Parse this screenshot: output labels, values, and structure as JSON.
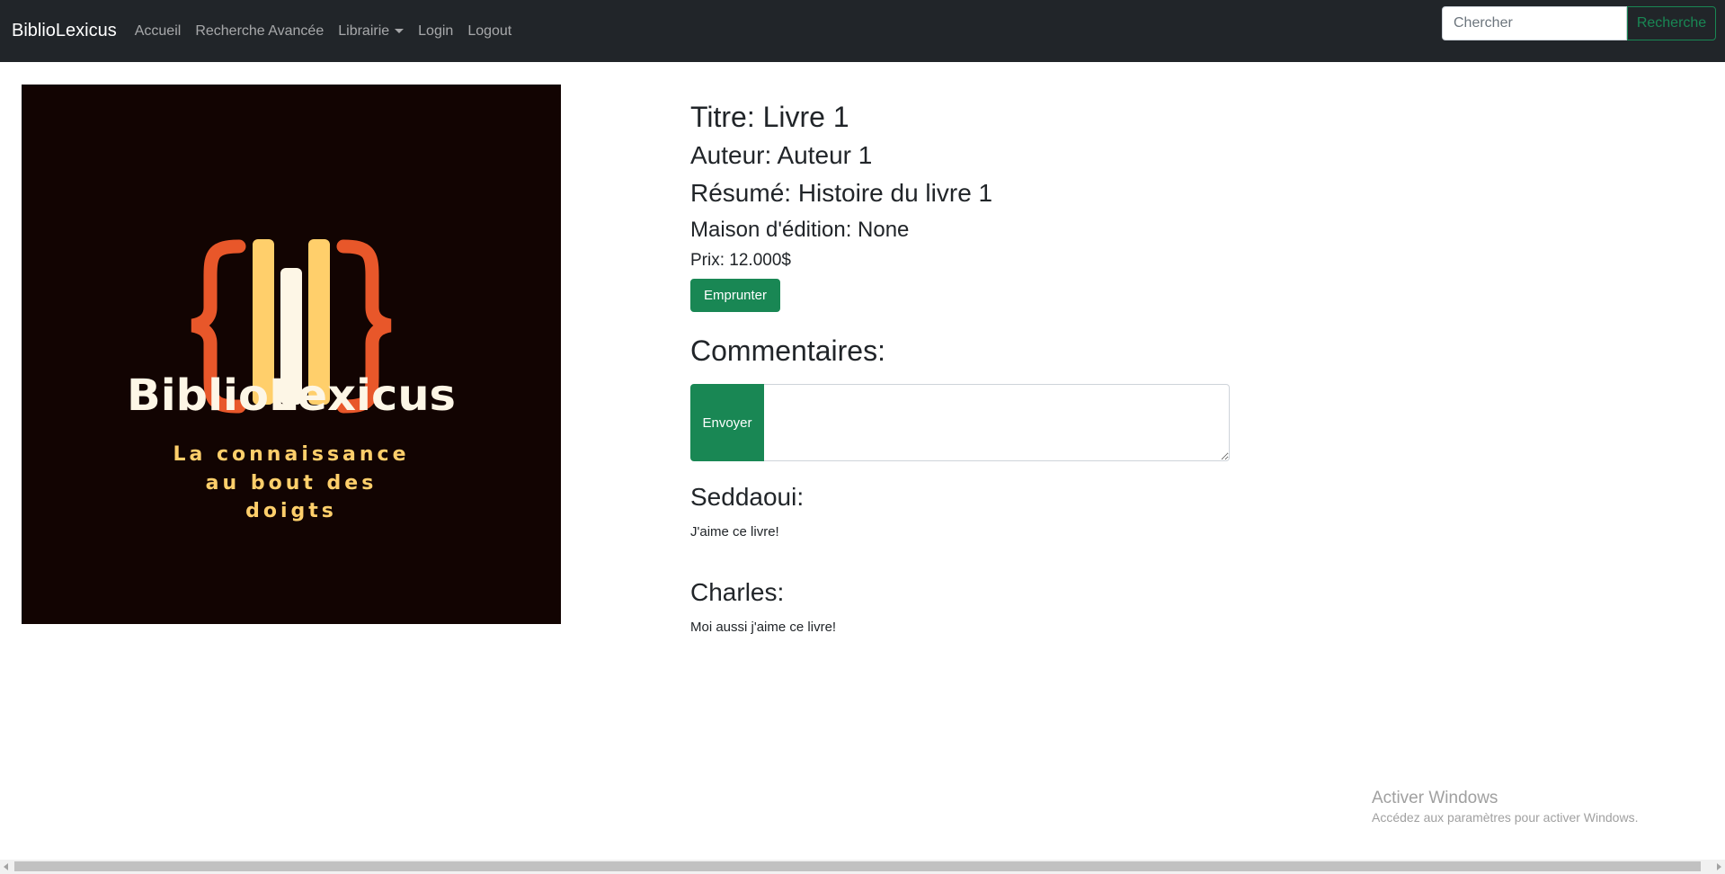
{
  "navbar": {
    "brand": "BiblioLexicus",
    "links": [
      "Accueil",
      "Recherche Avancée",
      "Librairie",
      "Login",
      "Logout"
    ],
    "search_placeholder": "Chercher",
    "search_button": "Recherche"
  },
  "cover": {
    "brand_text": "BiblioLexicus",
    "tagline_lines": [
      "La connaissance",
      "au bout des",
      "doigts"
    ],
    "colors": {
      "background": "#120402",
      "brace": "#e8572a",
      "book": "#ffcf6b",
      "book_center": "#fdf6e6",
      "text": "#fdf6e6"
    }
  },
  "book": {
    "title_line": "Titre: Livre 1",
    "author_line": "Auteur: Auteur 1",
    "summary_line": "Résumé: Histoire du livre 1",
    "publisher_line": "Maison d'édition: None",
    "price_line": "Prix: 12.000$",
    "borrow_button": "Emprunter"
  },
  "comments": {
    "heading": "Commentaires:",
    "send_button": "Envoyer",
    "textarea_value": "",
    "items": [
      {
        "author": "Seddaoui:",
        "text": "J'aime ce livre!"
      },
      {
        "author": "Charles:",
        "text": "Moi aussi j'aime ce livre!"
      }
    ]
  },
  "watermark": {
    "title": "Activer Windows",
    "subtitle": "Accédez aux paramètres pour activer Windows."
  },
  "colors": {
    "navbar": "#212529",
    "success": "#198754"
  }
}
